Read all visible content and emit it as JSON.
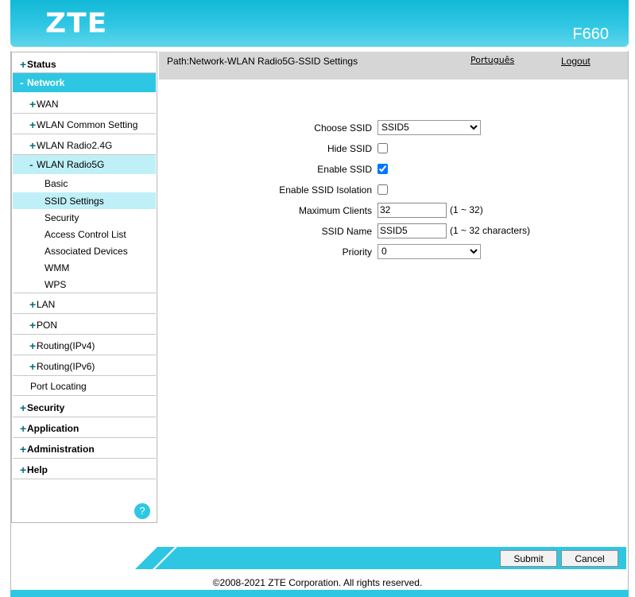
{
  "header": {
    "brand": "ZTE",
    "model": "F660"
  },
  "path_bar": {
    "path": "Path:Network-WLAN Radio5G-SSID Settings",
    "language": "Português",
    "logout": "Logout"
  },
  "sidebar": {
    "status": {
      "sign": "+",
      "label": "Status"
    },
    "network": {
      "sign": "-",
      "label": "Network"
    },
    "wan": {
      "sign": "+",
      "label": "WAN"
    },
    "wlan_common": {
      "sign": "+",
      "label": "WLAN Common Setting"
    },
    "wlan_24": {
      "sign": "+",
      "label": "WLAN Radio2.4G"
    },
    "wlan_5": {
      "sign": "-",
      "label": "WLAN Radio5G"
    },
    "wlan5_items": [
      "Basic",
      "SSID Settings",
      "Security",
      "Access Control List",
      "Associated Devices",
      "WMM",
      "WPS"
    ],
    "lan": {
      "sign": "+",
      "label": "LAN"
    },
    "pon": {
      "sign": "+",
      "label": "PON"
    },
    "routing4": {
      "sign": "+",
      "label": "Routing(IPv4)"
    },
    "routing6": {
      "sign": "+",
      "label": "Routing(IPv6)"
    },
    "port_locating": "Port Locating",
    "security": {
      "sign": "+",
      "label": "Security"
    },
    "application": {
      "sign": "+",
      "label": "Application"
    },
    "administration": {
      "sign": "+",
      "label": "Administration"
    },
    "help": {
      "sign": "+",
      "label": "Help"
    },
    "help_icon": "?"
  },
  "form": {
    "choose_ssid": {
      "label": "Choose SSID",
      "value": "SSID5"
    },
    "hide_ssid": {
      "label": "Hide SSID",
      "checked": false
    },
    "enable_ssid": {
      "label": "Enable SSID",
      "checked": true
    },
    "ssid_isolation": {
      "label": "Enable SSID Isolation",
      "checked": false
    },
    "max_clients": {
      "label": "Maximum Clients",
      "value": "32",
      "hint": "(1 ~ 32)"
    },
    "ssid_name": {
      "label": "SSID Name",
      "value": "SSID5",
      "hint": "(1 ~ 32 characters)"
    },
    "priority": {
      "label": "Priority",
      "value": "0"
    }
  },
  "buttons": {
    "submit": "Submit",
    "cancel": "Cancel"
  },
  "footer": {
    "copyright": "©2008-2021 ZTE Corporation. All rights reserved."
  },
  "colors": {
    "accent": "#2ec7e3",
    "active_sub": "#bff0f7",
    "path_bar": "#d6d6d6"
  }
}
